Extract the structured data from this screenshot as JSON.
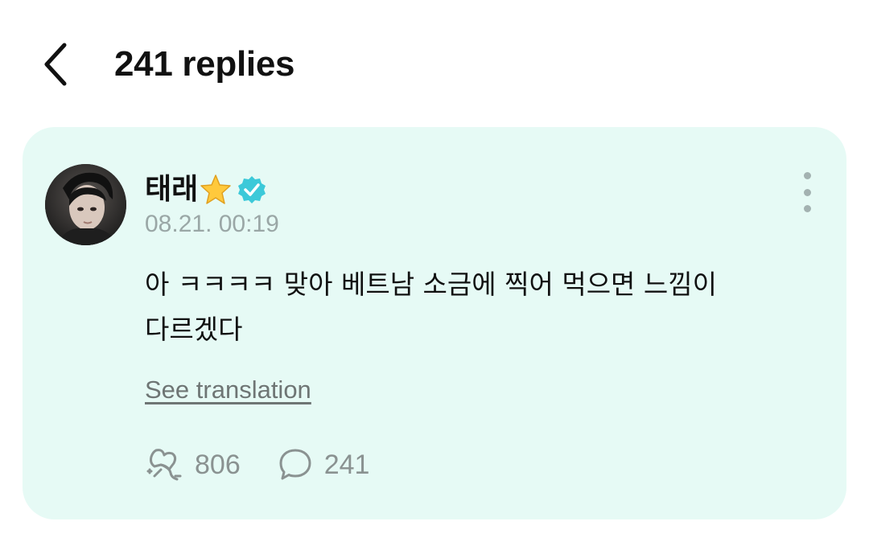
{
  "header": {
    "back_icon": "chevron-left-icon",
    "title": "241 replies"
  },
  "comment": {
    "username": "태래",
    "badge_icon": "star-icon",
    "verified_icon": "verified-badge-icon",
    "timestamp": "08.21. 00:19",
    "text": "아 ㅋㅋㅋㅋ 맞아 베트남 소금에 찍어 먹으면 느낌이 다르겠다",
    "translate_label": "See translation",
    "more_icon": "more-vertical-icon",
    "like_icon": "like-icon",
    "like_count": "806",
    "reply_icon": "comment-icon",
    "reply_count": "241"
  },
  "colors": {
    "card_background": "#e6faf5",
    "verified": "#3cc9d9",
    "meta_text": "#9aa7a6"
  }
}
